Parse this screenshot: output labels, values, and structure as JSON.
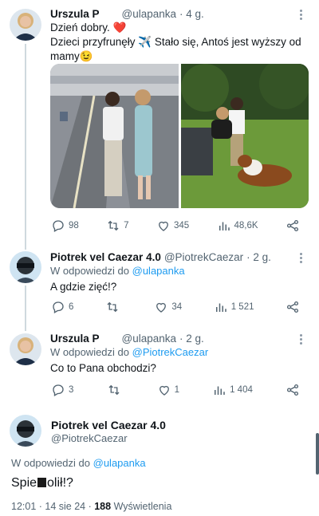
{
  "tweets": [
    {
      "name": "Urszula P",
      "handle": "@ulapanka",
      "time": "· 4 g.",
      "text_line1": "Dzień dobry. ❤️",
      "text_line2": "Dzieci przyfrunęły ✈️ Stało się, Antoś  jest wyższy  od mamy😉",
      "stats": {
        "replies": "98",
        "retweets": "7",
        "likes": "345",
        "views": "48,6K"
      }
    },
    {
      "name": "Piotrek vel Caezar 4.0",
      "handle": "@PiotrekCaezar",
      "time": "· 2 g.",
      "reply_prefix": "W odpowiedzi do",
      "reply_to": "@ulapanka",
      "text": "A gdzie zięć!?",
      "stats": {
        "replies": "6",
        "retweets": "",
        "likes": "34",
        "views": "1 521"
      }
    },
    {
      "name": "Urszula P",
      "handle": "@ulapanka",
      "time": "· 2 g.",
      "reply_prefix": "W odpowiedzi do",
      "reply_to": "@PiotrekCaezar",
      "text": "Co to Pana obchodzi?",
      "stats": {
        "replies": "3",
        "retweets": "",
        "likes": "1",
        "views": "1 404"
      }
    }
  ],
  "focused": {
    "name": "Piotrek vel Caezar 4.0",
    "handle": "@PiotrekCaezar",
    "reply_prefix": "W odpowiedzi do",
    "reply_to": "@ulapanka",
    "text_before": "Spie",
    "text_after": "olił!?",
    "meta_prefix": "12:01 · 14 sie 24 · ",
    "views": "188",
    "views_label": " Wyświetlenia"
  },
  "icons": [
    "reply-icon",
    "retweet-icon",
    "like-icon",
    "views-icon",
    "share-icon",
    "more-icon"
  ],
  "colors": {
    "link": "#1d9bf0",
    "muted": "#536471",
    "text": "#0f1419",
    "thread_line": "#cfd9de"
  }
}
